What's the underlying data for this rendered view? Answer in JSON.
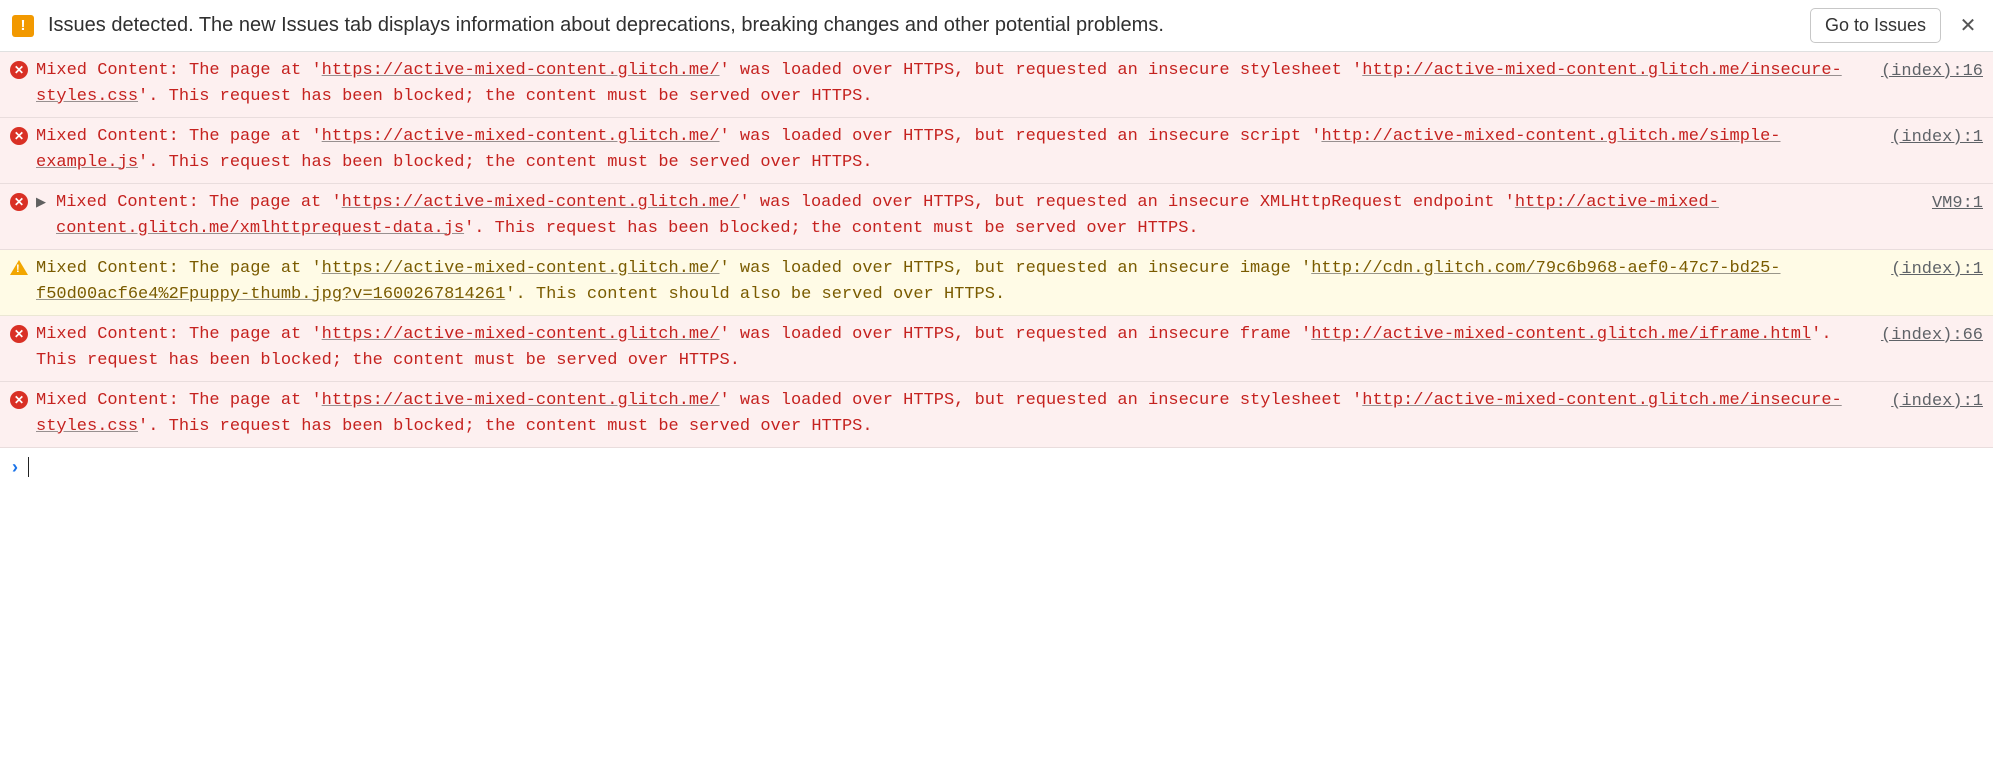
{
  "banner": {
    "message": "Issues detected. The new Issues tab displays information about deprecations, breaking changes and other potential problems.",
    "button_label": "Go to Issues"
  },
  "messages": [
    {
      "severity": "error",
      "expandable": false,
      "parts": [
        {
          "t": "Mixed Content: The page at '"
        },
        {
          "t": "https://active-mixed-content.glitch.me/",
          "u": true
        },
        {
          "t": "' was loaded over HTTPS, but requested an insecure stylesheet '"
        },
        {
          "t": "http://active-mixed-content.glitch.me/insecure-styles.css",
          "u": true
        },
        {
          "t": "'. This request has been blocked; the content must be served over HTTPS."
        }
      ],
      "source": "(index):16"
    },
    {
      "severity": "error",
      "expandable": false,
      "parts": [
        {
          "t": "Mixed Content: The page at '"
        },
        {
          "t": "https://active-mixed-content.glitch.me/",
          "u": true
        },
        {
          "t": "' was loaded over HTTPS, but requested an insecure script '"
        },
        {
          "t": "http://active-mixed-content.glitch.me/simple-example.js",
          "u": true
        },
        {
          "t": "'. This request has been blocked; the content must be served over HTTPS."
        }
      ],
      "source": "(index):1"
    },
    {
      "severity": "error",
      "expandable": true,
      "parts": [
        {
          "t": "Mixed Content: The page at '"
        },
        {
          "t": "https://active-mixed-content.glitch.me/",
          "u": true
        },
        {
          "t": "' was loaded over HTTPS, but requested an insecure XMLHttpRequest endpoint '"
        },
        {
          "t": "http://active-mixed-content.glitch.me/xmlhttprequest-data.js",
          "u": true
        },
        {
          "t": "'. This request has been blocked; the content must be served over HTTPS."
        }
      ],
      "source": "VM9:1"
    },
    {
      "severity": "warning",
      "expandable": false,
      "parts": [
        {
          "t": "Mixed Content: The page at '"
        },
        {
          "t": "https://active-mixed-content.glitch.me/",
          "u": true
        },
        {
          "t": "' was loaded over HTTPS, but requested an insecure image '"
        },
        {
          "t": "http://cdn.glitch.com/79c6b968-aef0-47c7-bd25-f50d00acf6e4%2Fpuppy-thumb.jpg?v=1600267814261",
          "u": true
        },
        {
          "t": "'. This content should also be served over HTTPS."
        }
      ],
      "source": "(index):1"
    },
    {
      "severity": "error",
      "expandable": false,
      "parts": [
        {
          "t": "Mixed Content: The page at '"
        },
        {
          "t": "https://active-mixed-content.glitch.me/",
          "u": true
        },
        {
          "t": "' was loaded over HTTPS, but requested an insecure frame '"
        },
        {
          "t": "http://active-mixed-content.glitch.me/iframe.html",
          "u": true
        },
        {
          "t": "'. This request has been blocked; the content must be served over HTTPS."
        }
      ],
      "source": "(index):66"
    },
    {
      "severity": "error",
      "expandable": false,
      "parts": [
        {
          "t": "Mixed Content: The page at '"
        },
        {
          "t": "https://active-mixed-content.glitch.me/",
          "u": true
        },
        {
          "t": "' was loaded over HTTPS, but requested an insecure stylesheet '"
        },
        {
          "t": "http://active-mixed-content.glitch.me/insecure-styles.css",
          "u": true
        },
        {
          "t": "'. This request has been blocked; the content must be served over HTTPS."
        }
      ],
      "source": "(index):1"
    }
  ]
}
